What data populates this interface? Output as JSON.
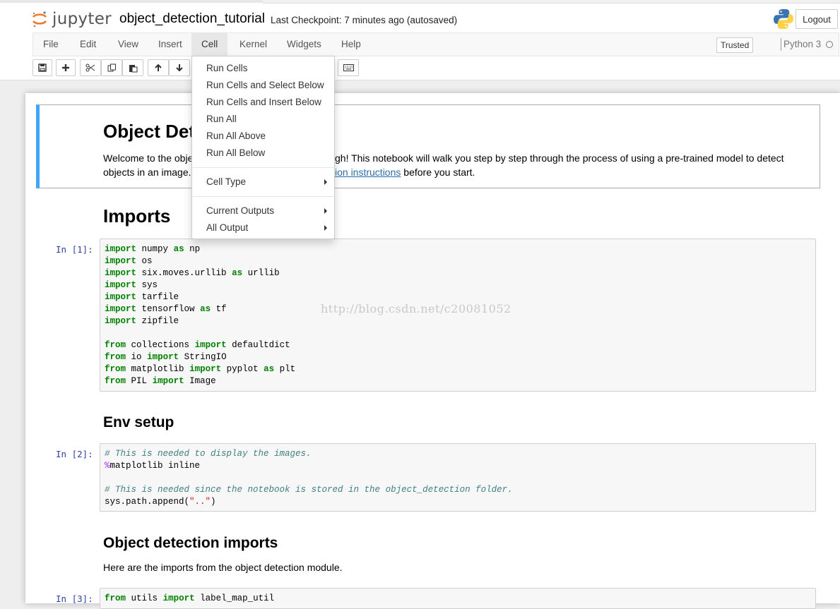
{
  "header": {
    "logo_text": "jupyter",
    "notebook_name": "object_detection_tutorial",
    "checkpoint": "Last Checkpoint: 7 minutes ago (autosaved)",
    "logout_label": "Logout"
  },
  "menubar": {
    "items": [
      "File",
      "Edit",
      "View",
      "Insert",
      "Cell",
      "Kernel",
      "Widgets",
      "Help"
    ],
    "active": "Cell",
    "trusted_label": "Trusted",
    "kernel_name": "Python 3"
  },
  "toolbar": {
    "icons": [
      "save-icon",
      "plus-icon",
      "cut-icon",
      "copy-icon",
      "paste-icon",
      "arrow-up-icon",
      "arrow-down-icon",
      "keyboard-icon"
    ]
  },
  "cell_menu": {
    "group1": [
      "Run Cells",
      "Run Cells and Select Below",
      "Run Cells and Insert Below",
      "Run All",
      "Run All Above",
      "Run All Below"
    ],
    "cell_type": "Cell Type",
    "current_outputs": "Current Outputs",
    "all_output": "All Output"
  },
  "cells": {
    "title": "Object Det",
    "intro_line1_a": "Welcome to the obje",
    "intro_line1_b": "gh! This notebook will walk you step by step through the process of using a pre-trained model to detect",
    "intro_line2_a": "objects in an image.",
    "intro_link": "ion instructions",
    "intro_line2_b": " before you start.",
    "imports_heading": "Imports",
    "prompt1": "In [1]:",
    "env_heading": "Env setup",
    "prompt2": "In [2]:",
    "od_imports_heading": "Object detection imports",
    "od_imports_text": "Here are the imports from the object detection module.",
    "prompt3": "In [3]:"
  },
  "code1": [
    [
      [
        "kw",
        "import"
      ],
      [
        "",
        "numpy"
      ],
      [
        "kw",
        "as"
      ],
      [
        "",
        "np"
      ]
    ],
    [
      [
        "kw",
        "import"
      ],
      [
        "",
        "os"
      ]
    ],
    [
      [
        "kw",
        "import"
      ],
      [
        "",
        "six.moves.urllib"
      ],
      [
        "kw",
        "as"
      ],
      [
        "",
        "urllib"
      ]
    ],
    [
      [
        "kw",
        "import"
      ],
      [
        "",
        "sys"
      ]
    ],
    [
      [
        "kw",
        "import"
      ],
      [
        "",
        "tarfile"
      ]
    ],
    [
      [
        "kw",
        "import"
      ],
      [
        "",
        "tensorflow"
      ],
      [
        "kw",
        "as"
      ],
      [
        "",
        "tf"
      ]
    ],
    [
      [
        "kw",
        "import"
      ],
      [
        "",
        "zipfile"
      ]
    ],
    [],
    [
      [
        "kw",
        "from"
      ],
      [
        "",
        "collections"
      ],
      [
        "kw",
        "import"
      ],
      [
        "",
        "defaultdict"
      ]
    ],
    [
      [
        "kw",
        "from"
      ],
      [
        "",
        "io"
      ],
      [
        "kw",
        "import"
      ],
      [
        "",
        "StringIO"
      ]
    ],
    [
      [
        "kw",
        "from"
      ],
      [
        "",
        "matplotlib"
      ],
      [
        "kw",
        "import"
      ],
      [
        "",
        "pyplot"
      ],
      [
        "kw",
        "as"
      ],
      [
        "",
        "plt"
      ]
    ],
    [
      [
        "kw",
        "from"
      ],
      [
        "",
        "PIL"
      ],
      [
        "kw",
        "import"
      ],
      [
        "",
        "Image"
      ]
    ]
  ],
  "code2": [
    [
      [
        "cm",
        "# This is needed to display the images."
      ]
    ],
    [
      [
        "mg",
        "%"
      ],
      [
        "",
        "matplotlib inline"
      ]
    ],
    [],
    [
      [
        "cm",
        "# This is needed since the notebook is stored in the object_detection folder."
      ]
    ],
    [
      [
        "",
        "sys.path.append("
      ],
      [
        "st",
        "\"..\""
      ],
      [
        "",
        ")"
      ]
    ]
  ],
  "code3": [
    [
      [
        "kw",
        "from"
      ],
      [
        "",
        "utils"
      ],
      [
        "kw",
        "import"
      ],
      [
        "",
        "label_map_util"
      ]
    ]
  ],
  "watermark": "http://blog.csdn.net/c20081052"
}
